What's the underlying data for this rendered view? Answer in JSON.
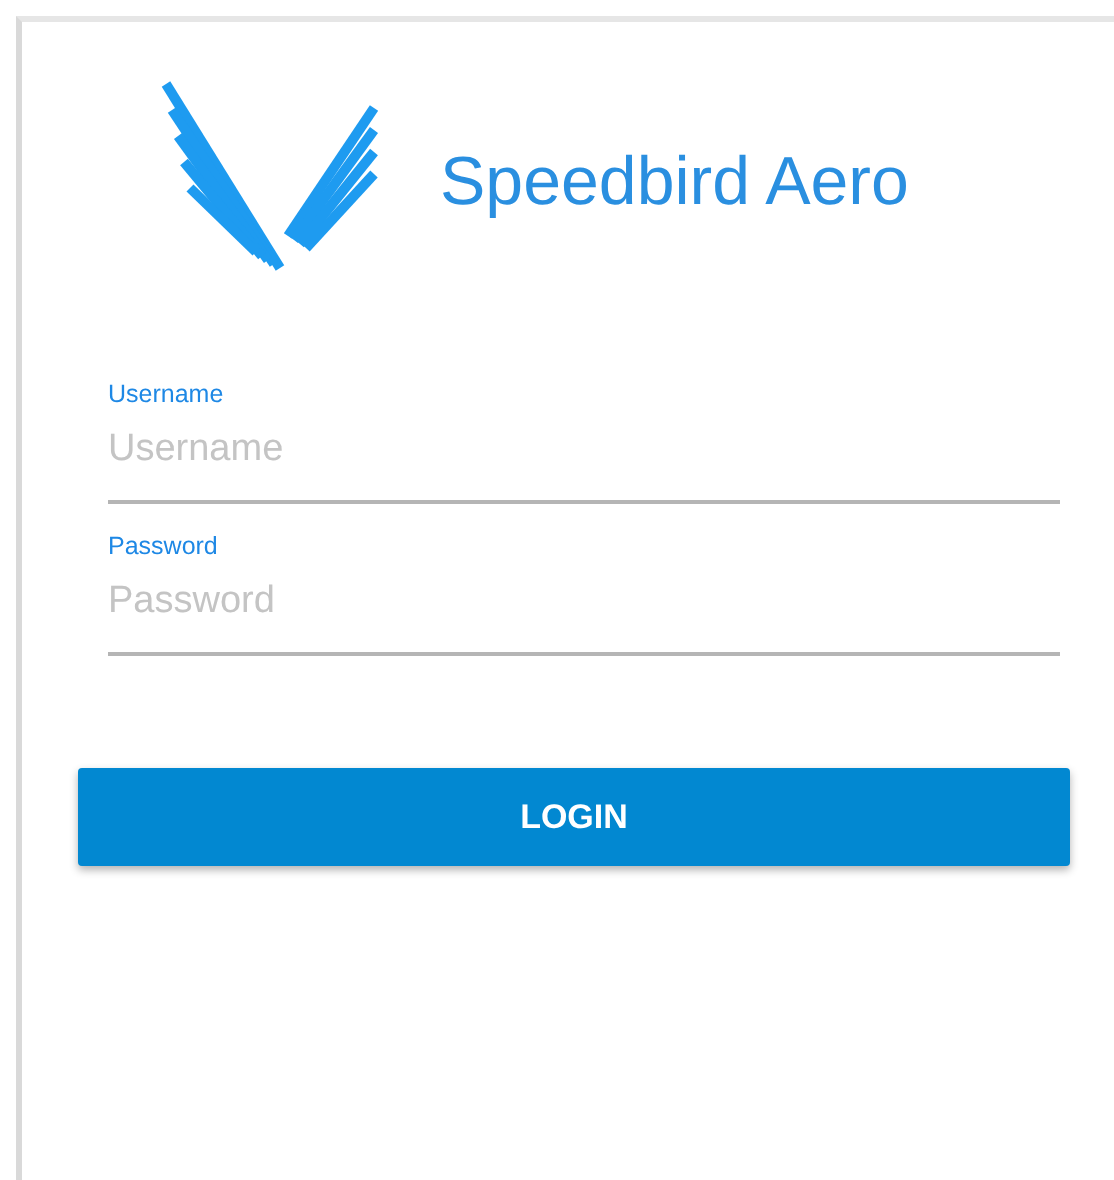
{
  "brand": {
    "name": "Speedbird Aero"
  },
  "fields": [
    {
      "label": "Username",
      "placeholder": "Username"
    },
    {
      "label": "Password",
      "placeholder": "Password"
    }
  ],
  "button": {
    "label": "LOGIN"
  }
}
